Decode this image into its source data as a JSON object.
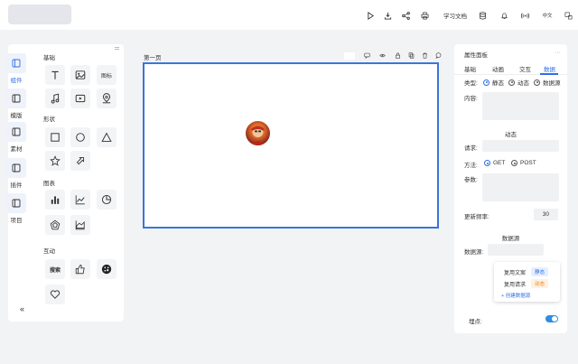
{
  "header": {
    "docs_label": "学习文档",
    "lang_label": "中文",
    "icons": [
      "play-icon",
      "download-icon",
      "share-icon",
      "print-icon",
      "database-icon",
      "bell-icon",
      "broadcast-icon",
      "translate-icon"
    ]
  },
  "sidebar": {
    "tabs": [
      {
        "label": "组件",
        "icon": "layout-icon",
        "active": true
      },
      {
        "label": "模版",
        "icon": "layout-icon"
      },
      {
        "label": "素材",
        "icon": "layout-icon"
      },
      {
        "label": "插件",
        "icon": "layout-icon"
      },
      {
        "label": "项目",
        "icon": "layout-icon"
      }
    ],
    "sections": {
      "basic": "基础",
      "shape": "形状",
      "chart": "图表",
      "interact": "互动"
    },
    "icon_label": "图标",
    "search_label": "搜索"
  },
  "canvas": {
    "page_title": "第一页"
  },
  "props": {
    "title": "属性面板",
    "tabs": [
      "基础",
      "动画",
      "交互",
      "数据"
    ],
    "type_label": "类型:",
    "type_options": [
      "静态",
      "动态",
      "数据源"
    ],
    "content_label": "内容:",
    "dynamic_header": "动态",
    "request_label": "请求:",
    "method_label": "方法:",
    "methods": [
      "GET",
      "POST"
    ],
    "params_label": "参数:",
    "refresh_label": "更新频率:",
    "refresh_value": "30",
    "datasource_header": "数据源",
    "datasource_label": "数据源:",
    "popup": {
      "rows": [
        {
          "text": "复用文案",
          "badge": "静态"
        },
        {
          "text": "复用请求",
          "badge": "动态"
        }
      ],
      "add": "+ 创建数据源"
    },
    "track_label": "埋点:",
    "track_on": true
  },
  "colors": {
    "accent": "#2f6fe4",
    "canvas_border": "#3b74dd"
  }
}
